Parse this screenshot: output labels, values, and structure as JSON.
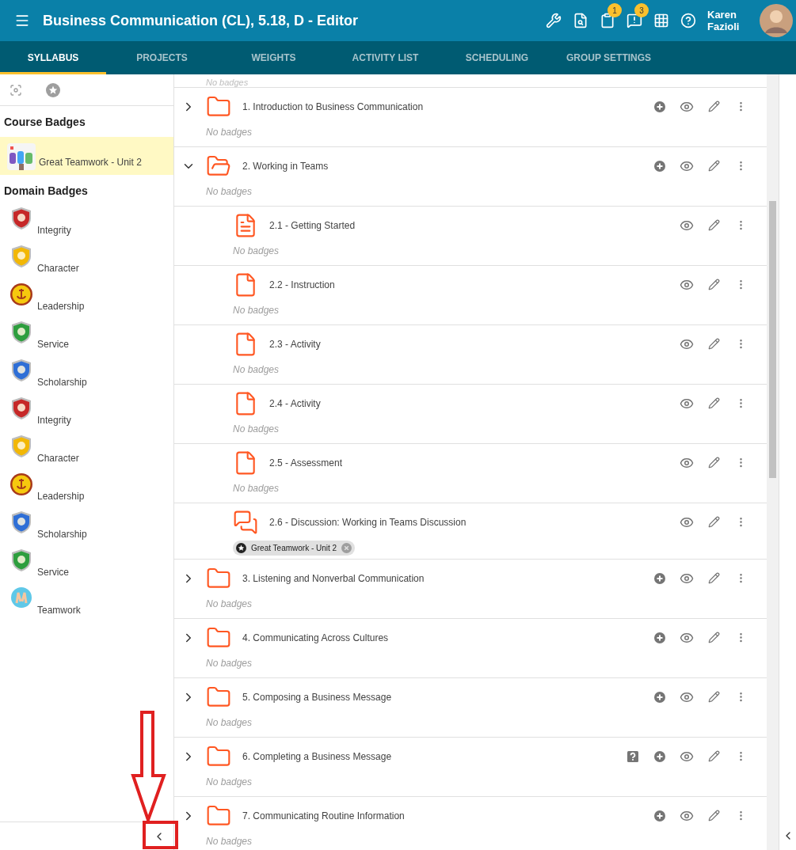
{
  "header": {
    "title": "Business Communication (CL), 5.18, D - Editor",
    "notification_counts": [
      "1",
      "3"
    ],
    "user_name": "Karen Fazioli"
  },
  "tabs": [
    {
      "label": "SYLLABUS",
      "selected": true
    },
    {
      "label": "PROJECTS",
      "selected": false
    },
    {
      "label": "WEIGHTS",
      "selected": false
    },
    {
      "label": "ACTIVITY LIST",
      "selected": false
    },
    {
      "label": "SCHEDULING",
      "selected": false
    },
    {
      "label": "GROUP SETTINGS",
      "selected": false
    }
  ],
  "sidebar": {
    "course_heading": "Course Badges",
    "course_badges": [
      {
        "name": "Great Teamwork - Unit 2",
        "selected": true
      }
    ],
    "domain_heading": "Domain Badges",
    "domain_badges": [
      {
        "name": "Integrity",
        "kind": "shield",
        "color": "#c62828"
      },
      {
        "name": "Character",
        "kind": "shield",
        "color": "#f2b705"
      },
      {
        "name": "Leadership",
        "kind": "medal",
        "color": "#f6c90e"
      },
      {
        "name": "Service",
        "kind": "shield",
        "color": "#2e9e3e"
      },
      {
        "name": "Scholarship",
        "kind": "shield",
        "color": "#2f6fd6"
      },
      {
        "name": "Integrity",
        "kind": "shield",
        "color": "#c62828"
      },
      {
        "name": "Character",
        "kind": "shield",
        "color": "#f2b705"
      },
      {
        "name": "Leadership",
        "kind": "medal",
        "color": "#f6c90e"
      },
      {
        "name": "Scholarship",
        "kind": "shield",
        "color": "#2f6fd6"
      },
      {
        "name": "Service",
        "kind": "shield",
        "color": "#2e9e3e"
      },
      {
        "name": "Teamwork",
        "kind": "round",
        "color": "#5fc8e8"
      }
    ]
  },
  "syllabus": {
    "previous_row_note": "No badges",
    "items": [
      {
        "title": "1. Introduction to Business Communication",
        "kind": "folder",
        "expanded": false,
        "flagged": false,
        "note": "No badges"
      },
      {
        "title": "2. Working in Teams",
        "kind": "folder",
        "expanded": true,
        "flagged": false,
        "note": "No badges",
        "children": [
          {
            "title": "2.1 - Getting Started",
            "kind": "page",
            "note": "No badges"
          },
          {
            "title": "2.2 - Instruction",
            "kind": "document",
            "note": "No badges"
          },
          {
            "title": "2.3 - Activity",
            "kind": "document",
            "note": "No badges"
          },
          {
            "title": "2.4 - Activity",
            "kind": "document",
            "note": "No badges"
          },
          {
            "title": "2.5 - Assessment",
            "kind": "document",
            "note": "No badges"
          },
          {
            "title": "2.6 - Discussion: Working in Teams Discussion",
            "kind": "discussion",
            "badges": [
              "Great Teamwork - Unit 2"
            ]
          }
        ]
      },
      {
        "title": "3. Listening and Nonverbal Communication",
        "kind": "folder",
        "expanded": false,
        "flagged": false,
        "note": "No badges"
      },
      {
        "title": "4. Communicating Across Cultures",
        "kind": "folder",
        "expanded": false,
        "flagged": false,
        "note": "No badges"
      },
      {
        "title": "5. Composing a Business Message",
        "kind": "folder",
        "expanded": false,
        "flagged": false,
        "note": "No badges"
      },
      {
        "title": "6. Completing a Business Message",
        "kind": "folder",
        "expanded": false,
        "flagged": true,
        "note": "No badges"
      },
      {
        "title": "7. Communicating Routine Information",
        "kind": "folder",
        "expanded": false,
        "flagged": false,
        "note": "No badges"
      }
    ]
  }
}
